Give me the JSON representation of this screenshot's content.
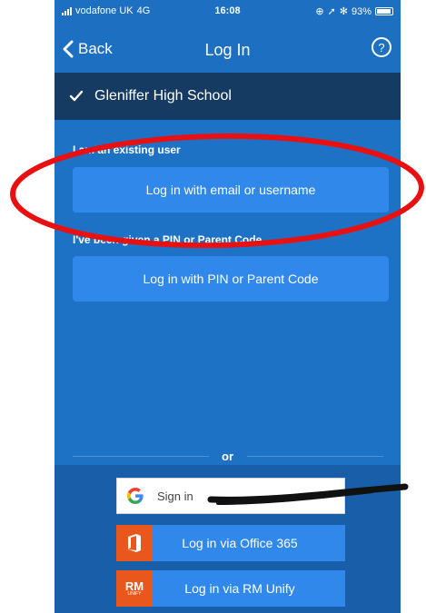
{
  "status_bar": {
    "carrier": "vodafone UK",
    "network": "4G",
    "time": "16:08",
    "battery": "93%"
  },
  "nav": {
    "back_label": "Back",
    "title": "Log In",
    "help_symbol": "?"
  },
  "school": {
    "name": "Gleniffer High School"
  },
  "sections": {
    "existing_user_label": "I am an existing user",
    "email_button": "Log in with email or username",
    "pin_label": "I've been given a PIN or Parent Code",
    "pin_button": "Log in with PIN or Parent Code"
  },
  "divider": {
    "text": "or"
  },
  "sso": {
    "google_label": "Sign in",
    "office_label": "Log in via Office 365",
    "rm_label": "Log in via RM Unify",
    "rm_logo_text": "RM",
    "rm_logo_sub": "UNIFY"
  },
  "colors": {
    "primary": "#1d72c6",
    "button": "#2f88ea",
    "school_row": "#153b63",
    "office_orange": "#e9571d",
    "annotation_red": "#e81010"
  }
}
